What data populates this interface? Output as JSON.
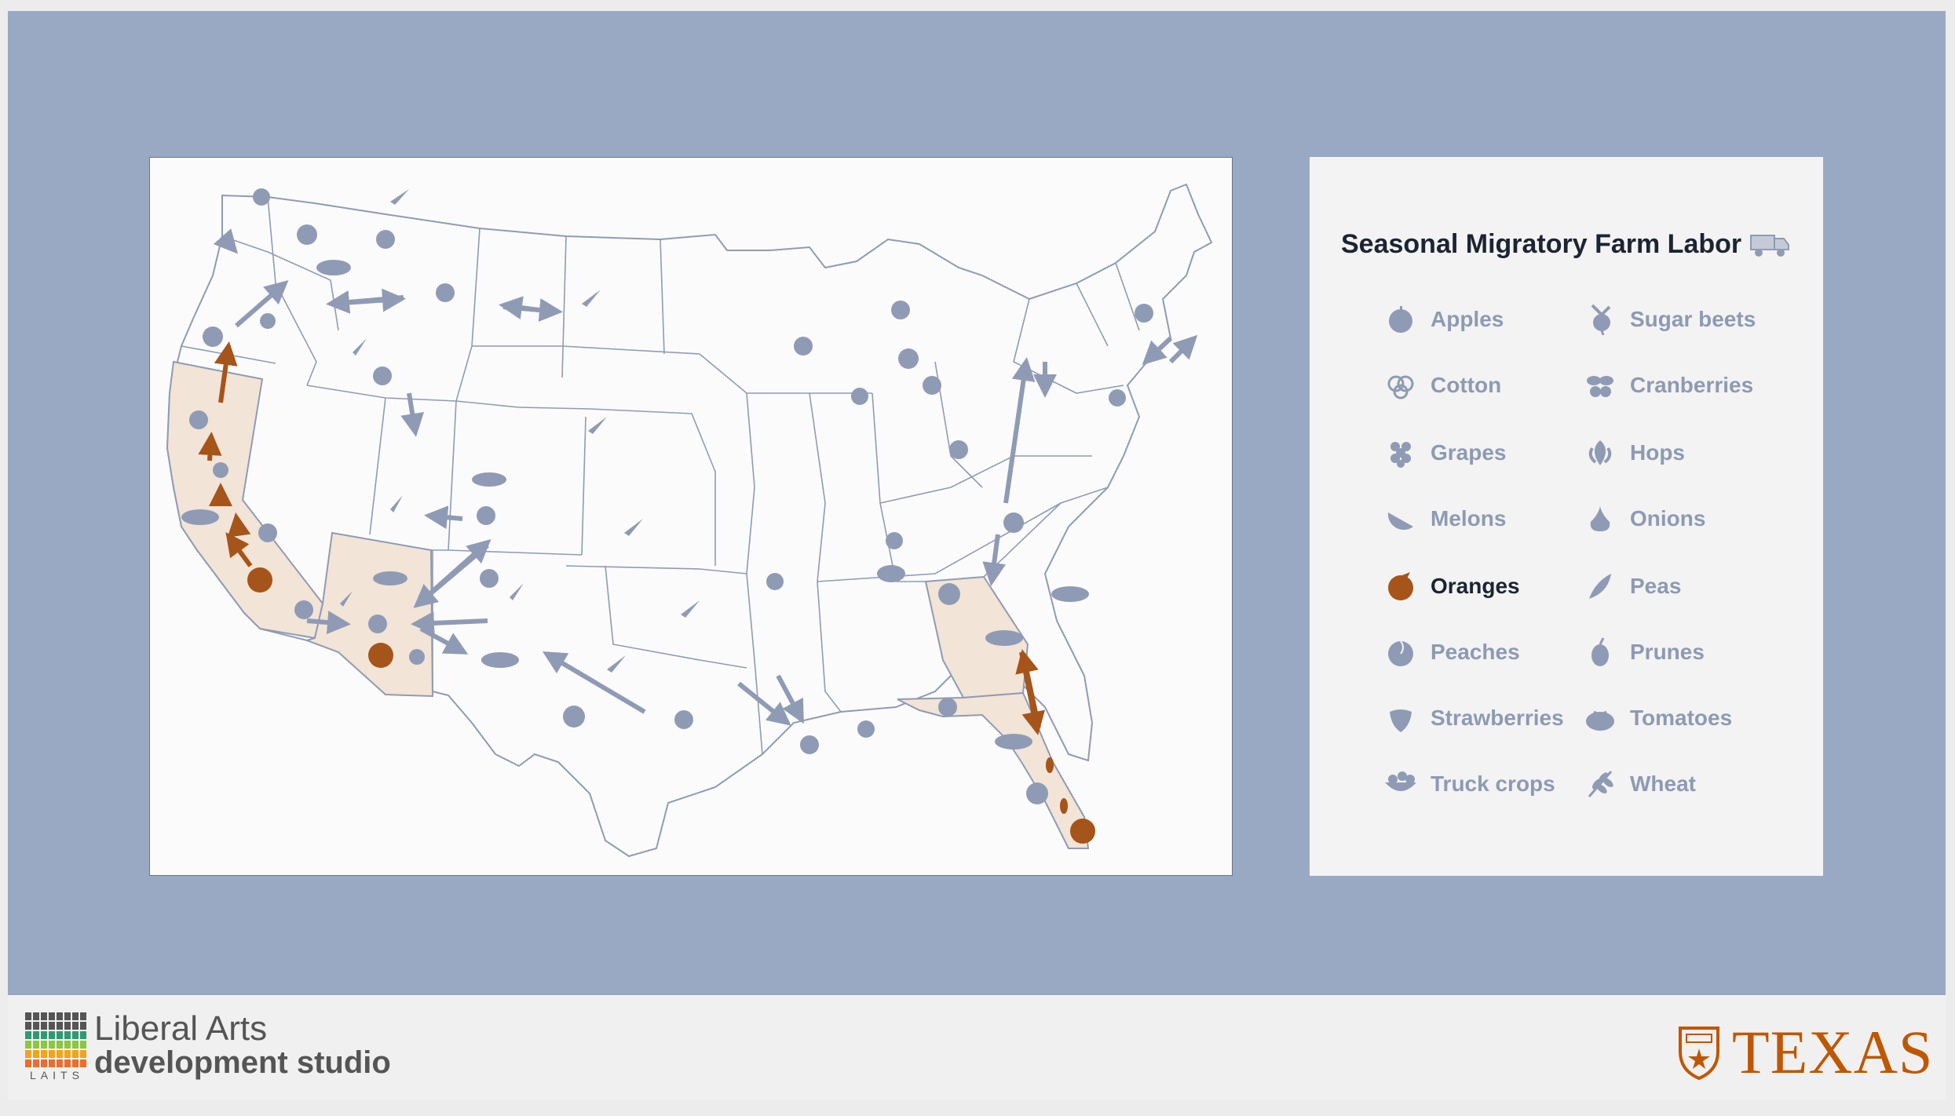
{
  "legend": {
    "title": "Seasonal Migratory Farm Labor",
    "truck_icon": "truck-icon",
    "items_left": [
      {
        "label": "Apples",
        "icon": "apple-icon",
        "active": false
      },
      {
        "label": "Cotton",
        "icon": "cotton-icon",
        "active": false
      },
      {
        "label": "Grapes",
        "icon": "grapes-icon",
        "active": false
      },
      {
        "label": "Melons",
        "icon": "melon-icon",
        "active": false
      },
      {
        "label": "Oranges",
        "icon": "orange-icon",
        "active": true
      },
      {
        "label": "Peaches",
        "icon": "peach-icon",
        "active": false
      },
      {
        "label": "Strawberries",
        "icon": "strawberry-icon",
        "active": false
      },
      {
        "label": "Truck crops",
        "icon": "truck-crops-icon",
        "active": false
      }
    ],
    "items_right": [
      {
        "label": "Sugar beets",
        "icon": "sugar-beet-icon",
        "active": false
      },
      {
        "label": "Cranberries",
        "icon": "cranberry-icon",
        "active": false
      },
      {
        "label": "Hops",
        "icon": "hops-icon",
        "active": false
      },
      {
        "label": "Onions",
        "icon": "onion-icon",
        "active": false
      },
      {
        "label": "Peas",
        "icon": "pea-icon",
        "active": false
      },
      {
        "label": "Prunes",
        "icon": "prune-icon",
        "active": false
      },
      {
        "label": "Tomatoes",
        "icon": "tomato-icon",
        "active": false
      },
      {
        "label": "Wheat",
        "icon": "wheat-icon",
        "active": false
      }
    ]
  },
  "map": {
    "highlighted_states": [
      "California",
      "Arizona",
      "Georgia",
      "Florida"
    ],
    "highlight_color": "#f2e4d6",
    "active_crop": "Oranges",
    "active_color": "#a5541a",
    "inactive_color": "#8f9bb5"
  },
  "footer": {
    "brand_line1": "Liberal Arts",
    "brand_line2": "development studio",
    "brand_abbrev": "LAITS",
    "university_word": "TEXAS",
    "texas_color": "#bf5700"
  },
  "colors": {
    "stage_bg": "#99a9c4",
    "panel_bg": "#fbfbfb",
    "legend_bg": "#f3f3f3"
  }
}
